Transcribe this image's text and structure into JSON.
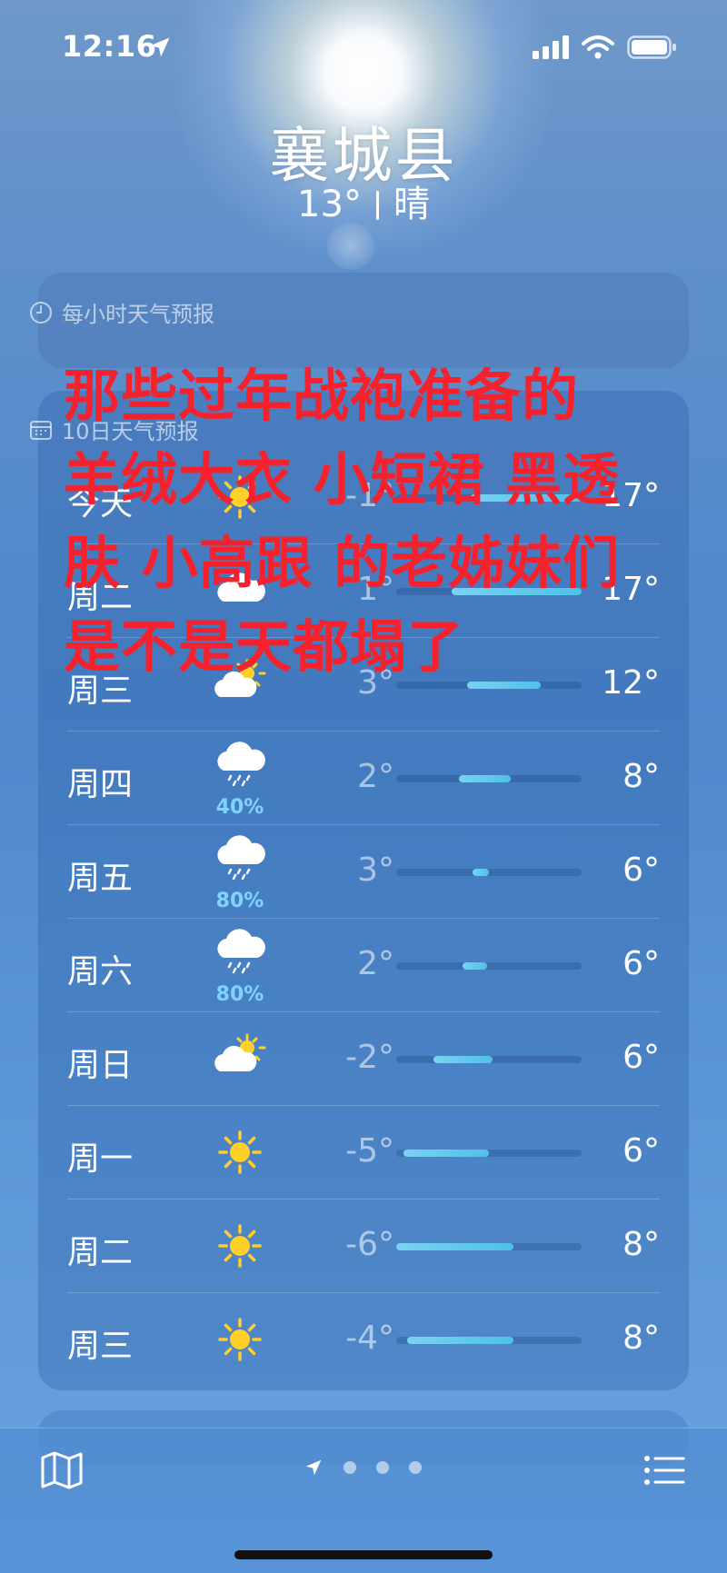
{
  "status_bar": {
    "time": "12:16",
    "icons": [
      "location-arrow-icon",
      "signal-icon",
      "wifi-icon",
      "battery-icon"
    ]
  },
  "location": {
    "city": "襄城县",
    "current_temp": "13°",
    "condition": "晴"
  },
  "hourly": {
    "header": "每小时天气预报",
    "icon": "clock-icon"
  },
  "daily": {
    "header": "10日天气预报",
    "icon": "calendar-icon",
    "days": [
      {
        "day": "今天",
        "icon": "sun-icon",
        "low": "-1°",
        "high": "17°",
        "precip": "",
        "range": [
          0.4,
          1.0
        ]
      },
      {
        "day": "周二",
        "icon": "cloud-icon",
        "low": "1°",
        "high": "17°",
        "precip": "",
        "range": [
          0.3,
          1.0
        ]
      },
      {
        "day": "周三",
        "icon": "partly-cloudy-icon",
        "low": "3°",
        "high": "12°",
        "precip": "",
        "range": [
          0.38,
          0.78
        ]
      },
      {
        "day": "周四",
        "icon": "rain-icon",
        "low": "2°",
        "high": "8°",
        "precip": "40%",
        "range": [
          0.34,
          0.62
        ]
      },
      {
        "day": "周五",
        "icon": "rain-icon",
        "low": "3°",
        "high": "6°",
        "precip": "80%",
        "range": [
          0.41,
          0.5
        ]
      },
      {
        "day": "周六",
        "icon": "rain-icon",
        "low": "2°",
        "high": "6°",
        "precip": "80%",
        "range": [
          0.36,
          0.49
        ]
      },
      {
        "day": "周日",
        "icon": "partly-cloudy-icon",
        "low": "-2°",
        "high": "6°",
        "precip": "",
        "range": [
          0.2,
          0.52
        ]
      },
      {
        "day": "周一",
        "icon": "sun-icon",
        "low": "-5°",
        "high": "6°",
        "precip": "",
        "range": [
          0.04,
          0.5
        ]
      },
      {
        "day": "周二",
        "icon": "sun-icon",
        "low": "-6°",
        "high": "8°",
        "precip": "",
        "range": [
          0.0,
          0.63
        ]
      },
      {
        "day": "周三",
        "icon": "sun-icon",
        "low": "-4°",
        "high": "8°",
        "precip": "",
        "range": [
          0.06,
          0.63
        ]
      }
    ]
  },
  "overlay_text": {
    "lines": [
      "那些过年战袍准备的",
      "羊绒大衣 小短裙 黑透",
      "肤 小高跟 的老姊妹们",
      "是不是天都塌了"
    ],
    "color": "#f5222d"
  },
  "bottom_bar": {
    "icons": [
      "map-icon",
      "location-arrow-icon",
      "list-icon"
    ],
    "page_count": 3
  },
  "colors": {
    "background": "#4f88cc",
    "precip": "#7fd4ff",
    "temp_bar": "#4ec1e8",
    "sun": "#ffd02a"
  }
}
